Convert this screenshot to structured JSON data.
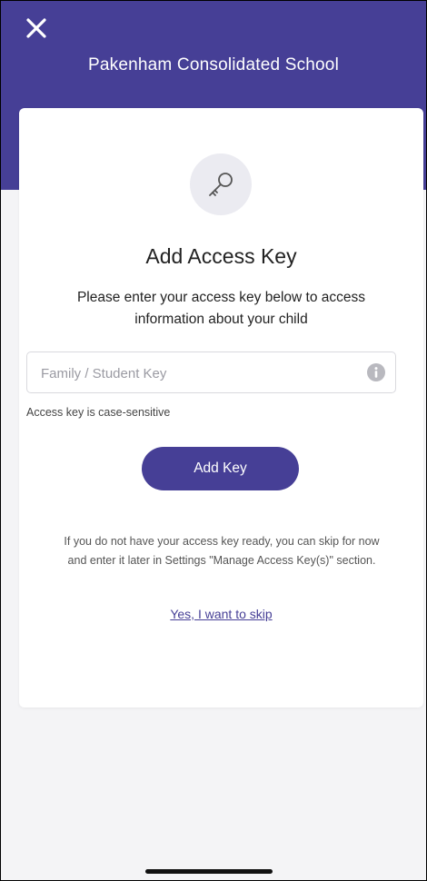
{
  "header": {
    "title": "Pakenham Consolidated School",
    "close_icon": "close-icon",
    "background_color": "#463f96"
  },
  "card": {
    "icon": "key-icon",
    "title": "Add Access Key",
    "description": "Please enter your access key below to access information about your child",
    "key_input": {
      "value": "",
      "placeholder": "Family / Student Key",
      "info_icon": "info-icon"
    },
    "hint": "Access key is case-sensitive",
    "add_key_label": "Add Key",
    "skip_info": "If you do not have your access key ready, you can skip for now and enter it later in Settings \"Manage Access Key(s)\" section.",
    "skip_link_label": "Yes, I want to skip"
  },
  "colors": {
    "accent": "#463f96",
    "background": "#f4f4f6",
    "card": "#ffffff"
  }
}
